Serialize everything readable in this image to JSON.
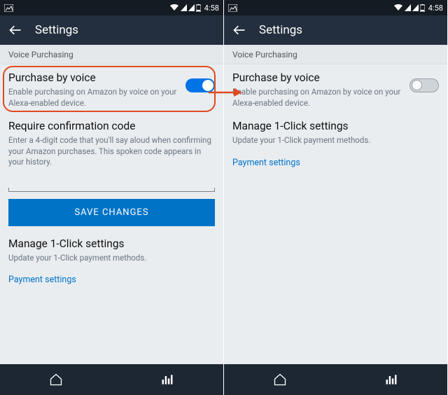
{
  "statusbar": {
    "time": "4:58"
  },
  "appbar": {
    "title": "Settings"
  },
  "section": {
    "header": "Voice Purchasing"
  },
  "left": {
    "purchase": {
      "title": "Purchase by voice",
      "desc": "Enable purchasing on Amazon by voice on your Alexa-enabled device.",
      "toggle_on": true
    },
    "confirm": {
      "title": "Require confirmation code",
      "desc": "Enter a 4-digit code that you'll say aloud when confirming your Amazon purchases. This spoken code appears in your history."
    },
    "save_label": "SAVE CHANGES",
    "manage": {
      "title": "Manage 1-Click settings",
      "desc": "Update your 1-Click payment methods."
    },
    "payment_link": "Payment settings"
  },
  "right": {
    "purchase": {
      "title": "Purchase by voice",
      "desc": "Enable purchasing on Amazon by voice on your Alexa-enabled device.",
      "toggle_on": false
    },
    "manage": {
      "title": "Manage 1-Click settings",
      "desc": "Update your 1-Click payment methods."
    },
    "payment_link": "Payment settings"
  },
  "colors": {
    "accent": "#0073c6",
    "appbar": "#232f3e",
    "highlight": "#e0491f"
  }
}
